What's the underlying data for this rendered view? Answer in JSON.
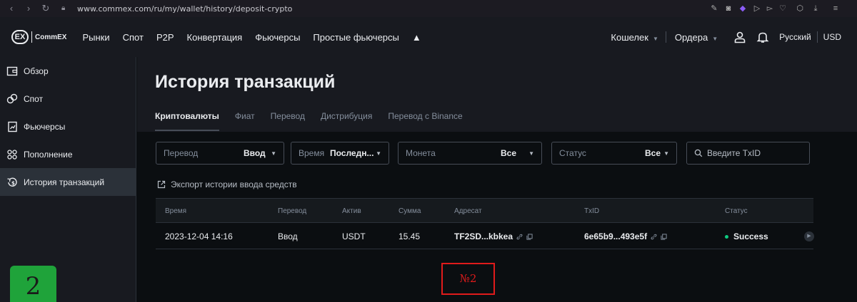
{
  "browser": {
    "url": "www.commex.com/ru/my/wallet/history/deposit-crypto"
  },
  "header": {
    "logo_mark": "EX",
    "logo_text": "CommEX",
    "nav": [
      "Рынки",
      "Спот",
      "P2P",
      "Конвертация",
      "Фьючерсы",
      "Простые фьючерсы"
    ],
    "wallet_label": "Кошелек",
    "orders_label": "Ордера",
    "language": "Русский",
    "currency": "USD"
  },
  "sidebar": {
    "items": [
      {
        "label": "Обзор",
        "icon": "wallet-icon"
      },
      {
        "label": "Спот",
        "icon": "spot-icon"
      },
      {
        "label": "Фьючерсы",
        "icon": "futures-icon"
      },
      {
        "label": "Пополнение",
        "icon": "deposit-icon"
      },
      {
        "label": "История транзакций",
        "icon": "history-icon"
      }
    ],
    "active_index": 4
  },
  "page": {
    "title": "История транзакций",
    "tabs": [
      "Криптовалюты",
      "Фиат",
      "Перевод",
      "Дистрибуция",
      "Перевод с Binance"
    ],
    "active_tab": 0
  },
  "filters": {
    "transfer": {
      "label": "Перевод",
      "value": "Ввод"
    },
    "time": {
      "label": "Время",
      "value": "Последн..."
    },
    "coin": {
      "label": "Монета",
      "value": "Все"
    },
    "status": {
      "label": "Статус",
      "value": "Все"
    },
    "txid_placeholder": "Введите TxID"
  },
  "export_label": "Экспорт истории ввода средств",
  "table": {
    "headers": [
      "Время",
      "Перевод",
      "Актив",
      "Сумма",
      "Адресат",
      "TxID",
      "Статус"
    ],
    "rows": [
      {
        "time": "2023-12-04 14:16",
        "type": "Ввод",
        "asset": "USDT",
        "amount": "15.45",
        "address": "TF2SD...kbkea",
        "txid": "6e65b9...493e5f",
        "status": "Success"
      }
    ]
  },
  "annotations": {
    "box_label": "№2",
    "badge_label": "2"
  },
  "colors": {
    "background": "#0b0e11",
    "panel": "#181a20",
    "success": "#0ecb81",
    "annotation_red": "#e01b1b",
    "badge_green": "#1fa33a"
  }
}
